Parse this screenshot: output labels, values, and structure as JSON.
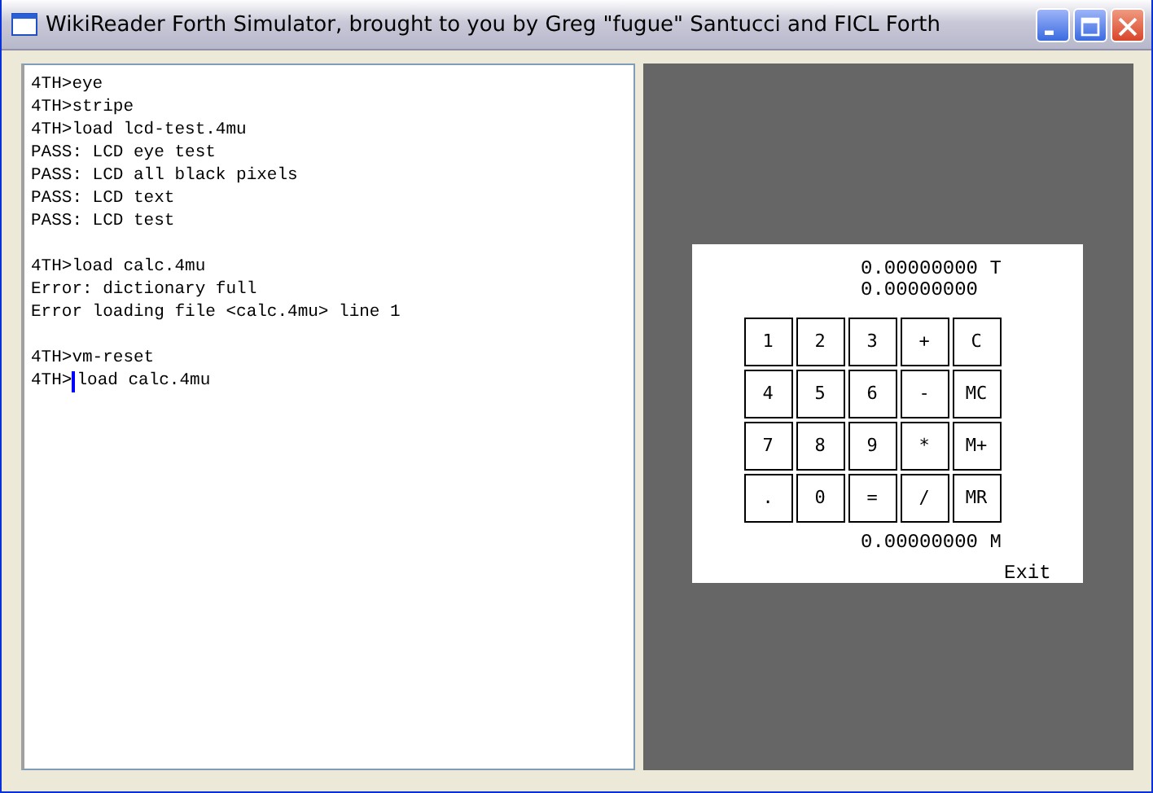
{
  "window": {
    "title": "WikiReader Forth Simulator, brought to you by Greg \"fugue\" Santucci and FICL Forth"
  },
  "console": {
    "blocks": [
      [
        "4TH>eye",
        "4TH>stripe",
        "4TH>load lcd-test.4mu",
        "PASS: LCD eye test",
        "PASS: LCD all black pixels",
        "PASS: LCD text",
        "PASS: LCD test"
      ],
      [
        "4TH>load calc.4mu",
        "Error: dictionary full",
        "Error loading file <calc.4mu> line 1"
      ],
      [
        "4TH>vm-reset"
      ]
    ],
    "input_line": {
      "prompt": "4TH>",
      "text": "load calc.4mu"
    }
  },
  "lcd": {
    "top_lines": [
      "0.00000000 T",
      "0.00000000"
    ],
    "keys": [
      [
        "1",
        "2",
        "3",
        "+",
        "C"
      ],
      [
        "4",
        "5",
        "6",
        "-",
        "MC"
      ],
      [
        "7",
        "8",
        "9",
        "*",
        "M+"
      ],
      [
        ".",
        "0",
        "=",
        "/",
        "MR"
      ]
    ],
    "memory_line": "0.00000000 M",
    "exit_label": "Exit"
  }
}
